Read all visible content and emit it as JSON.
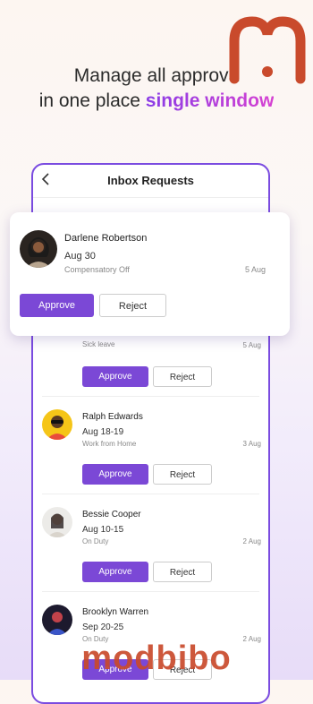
{
  "headline": {
    "line1": "Manage all approva",
    "line2_prefix": "in one place ",
    "line2_accent": "single window"
  },
  "app": {
    "title": "Inbox Requests",
    "back_icon": "chevron-left-icon",
    "accent_color": "#7b48d6"
  },
  "popup": {
    "name": "Darlene Robertson",
    "date": "Aug 30",
    "type": "Compensatory Off",
    "stamp": "5 Aug",
    "approve": "Approve",
    "reject": "Reject"
  },
  "requests": [
    {
      "type": "Sick leave",
      "stamp": "5 Aug",
      "approve": "Approve",
      "reject": "Reject"
    },
    {
      "name": "Ralph Edwards",
      "date": "Aug 18-19",
      "type": "Work from Home",
      "stamp": "3 Aug",
      "approve": "Approve",
      "reject": "Reject"
    },
    {
      "name": "Bessie Cooper",
      "date": "Aug 10-15",
      "type": "On Duty",
      "stamp": "2 Aug",
      "approve": "Approve",
      "reject": "Reject"
    },
    {
      "name": "Brooklyn Warren",
      "date": "Sep 20-25",
      "type": "On Duty",
      "stamp": "2 Aug",
      "approve": "Approve",
      "reject": "Reject"
    }
  ],
  "watermark": {
    "text": "modbibo",
    "logo": "modbibo-m-logo"
  }
}
